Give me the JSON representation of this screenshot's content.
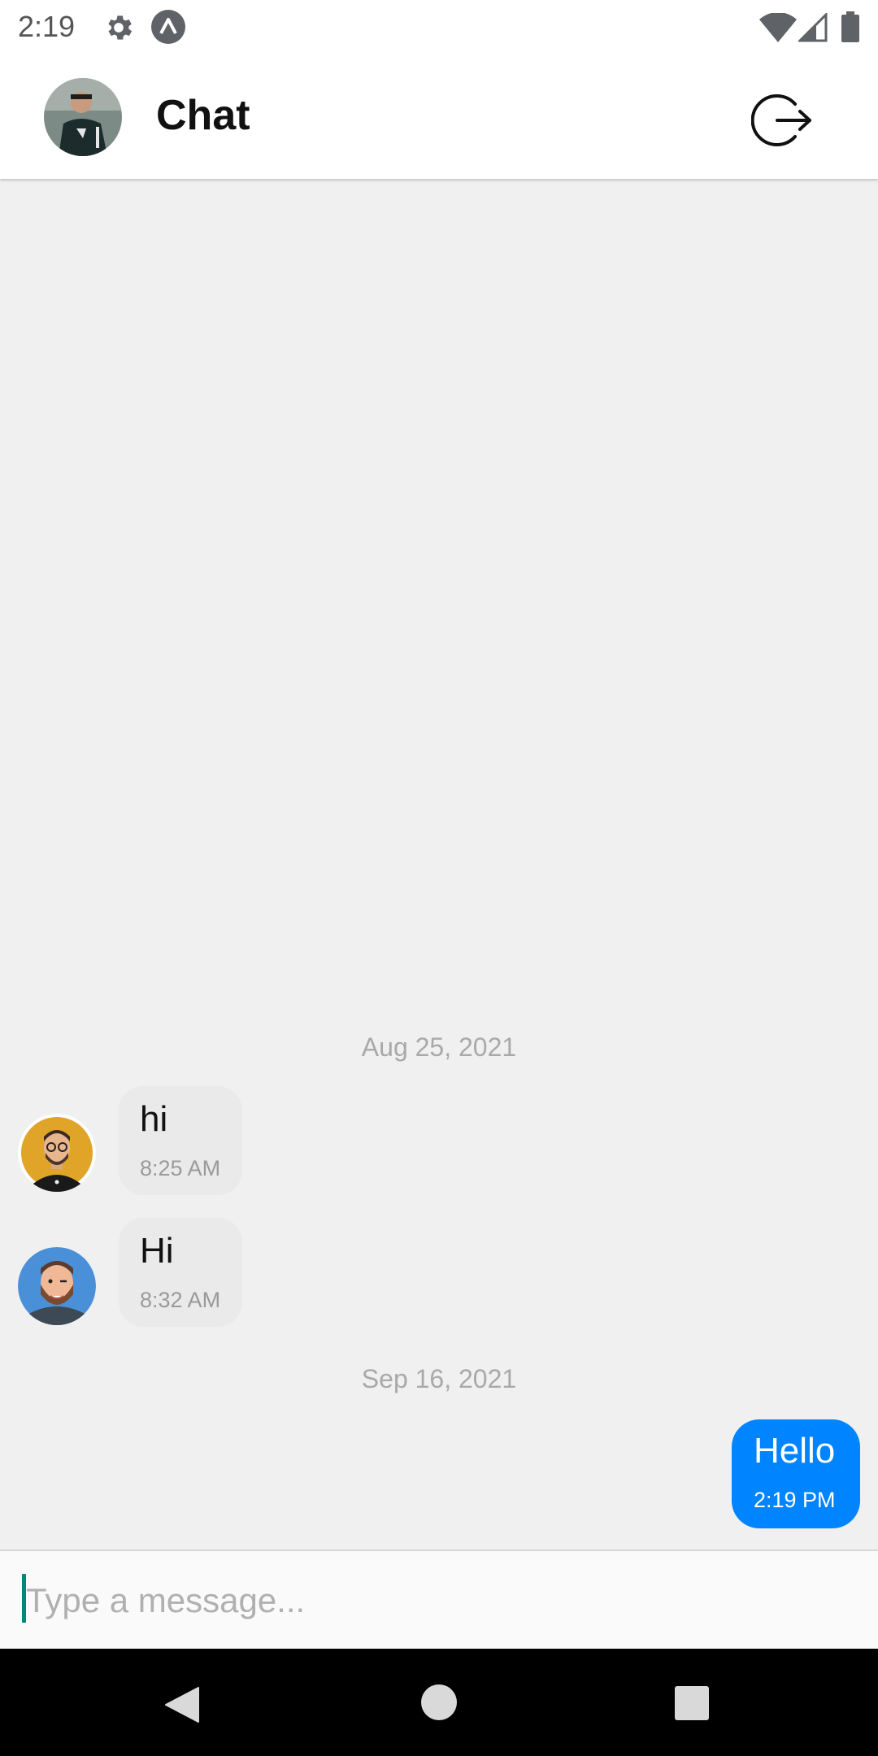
{
  "status_bar": {
    "time": "2:19",
    "icons": [
      "gear-icon",
      "app-a-icon",
      "wifi-icon",
      "signal-icon",
      "battery-icon"
    ]
  },
  "header": {
    "title": "Chat",
    "avatar": "user-profile-photo",
    "logout_icon": "logout-icon"
  },
  "conversation": {
    "groups": [
      {
        "date": "Aug 25, 2021",
        "messages": [
          {
            "text": "hi",
            "time": "8:25 AM",
            "direction": "incoming",
            "avatar": "glasses-man-avatar"
          },
          {
            "text": "Hi",
            "time": "8:32 AM",
            "direction": "incoming",
            "avatar": "bearded-man-avatar"
          }
        ]
      },
      {
        "date": "Sep 16, 2021",
        "messages": [
          {
            "text": "Hello",
            "time": "2:19 PM",
            "direction": "outgoing"
          }
        ]
      }
    ]
  },
  "composer": {
    "placeholder": "Type a message...",
    "value": ""
  },
  "colors": {
    "outgoing_bubble": "#0084ff",
    "incoming_bubble": "#eaeaea",
    "background": "#f0f0f0",
    "caret": "#00897b"
  },
  "nav_bar": {
    "icons": [
      "back-icon",
      "home-icon",
      "recents-icon"
    ]
  }
}
